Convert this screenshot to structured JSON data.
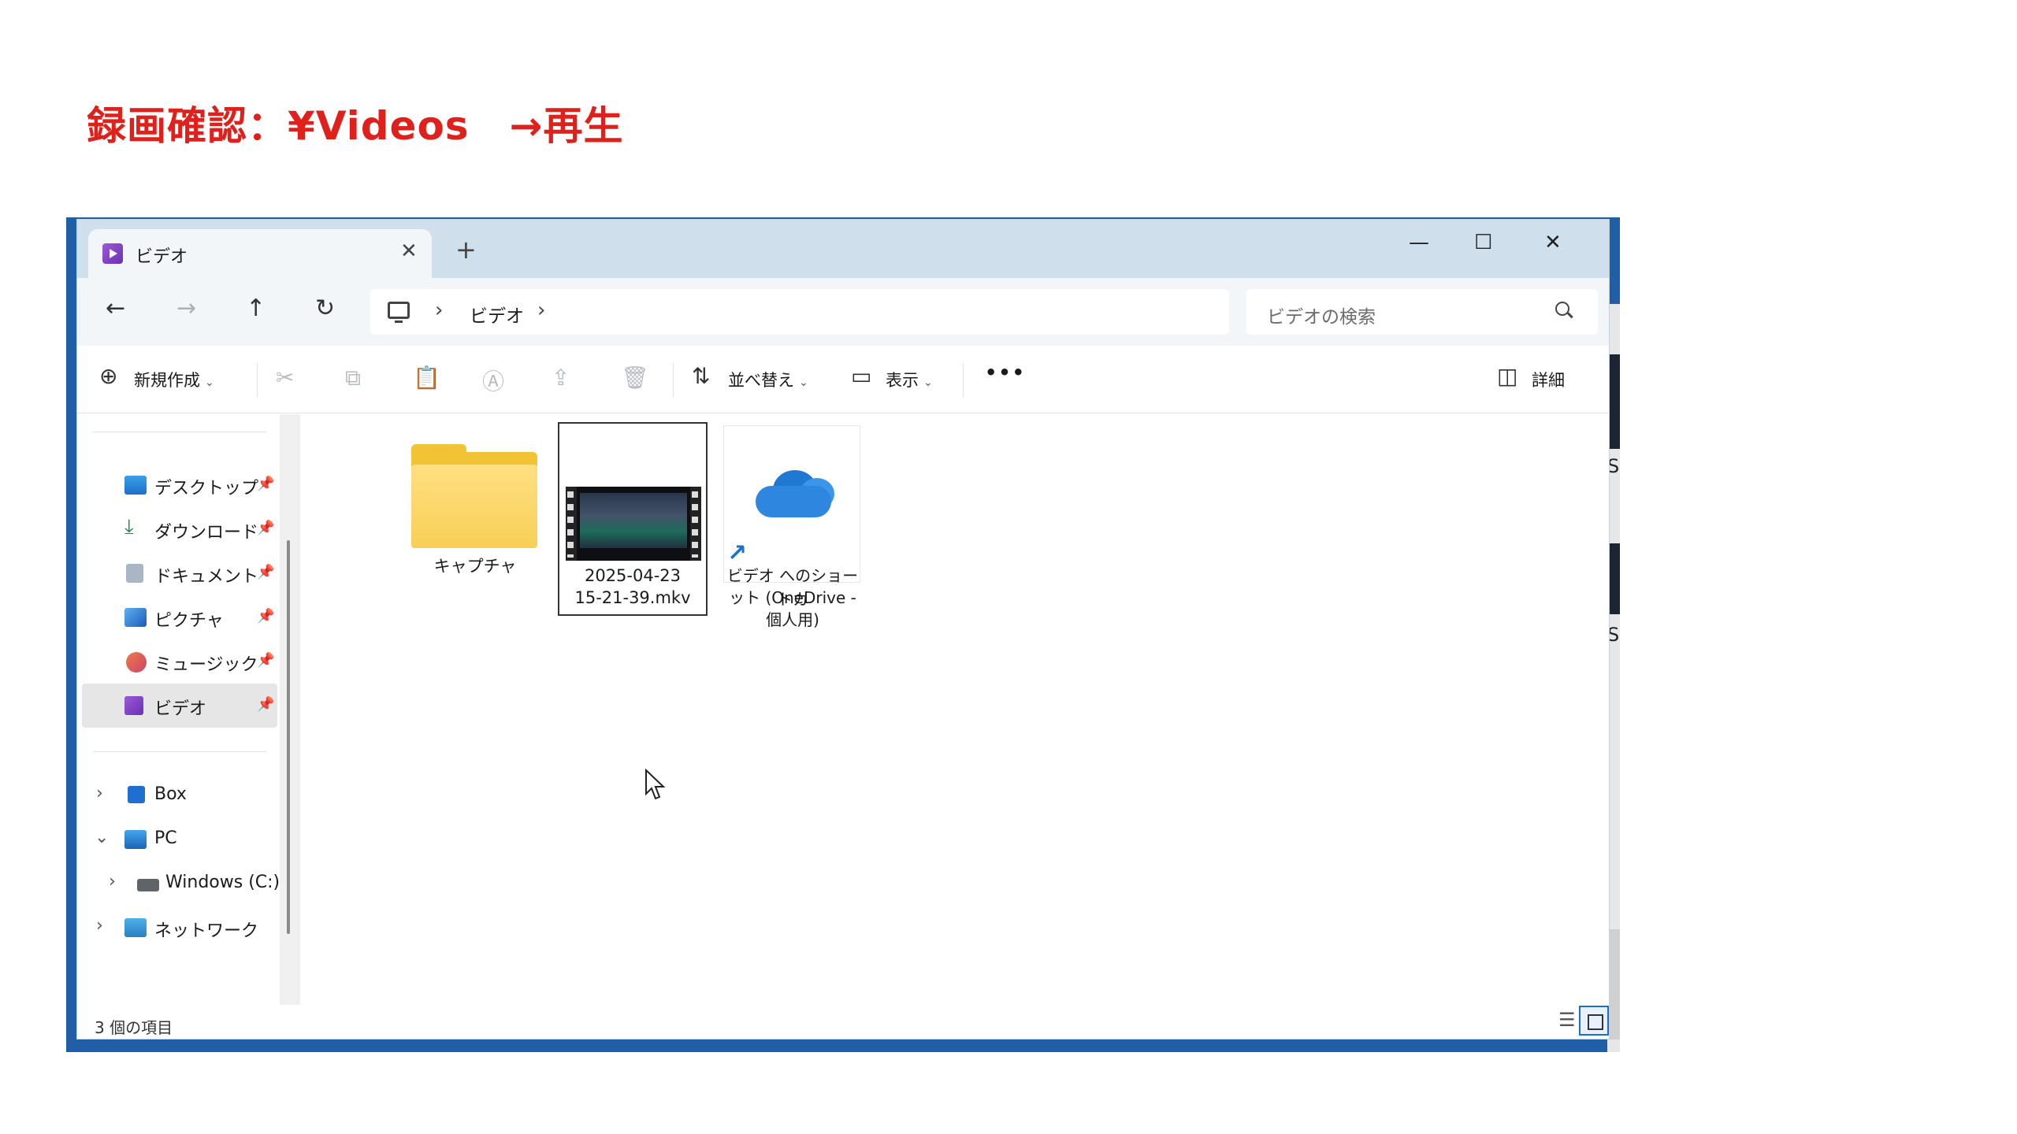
{
  "slide": {
    "title": "録画確認：¥Videos　→再生"
  },
  "window": {
    "tab_title": "ビデオ",
    "tab_close": "✕",
    "new_tab": "+",
    "minimize": "—",
    "maximize": "☐",
    "close": "✕"
  },
  "nav": {
    "back": "←",
    "forward": "→",
    "up": "↑",
    "refresh": "↻",
    "breadcrumb": [
      "ビデオ"
    ],
    "chevron": "›",
    "search_placeholder": "ビデオの検索"
  },
  "commands": {
    "new": "新規作成",
    "sort": "並べ替え",
    "view": "表示",
    "more": "•••",
    "details": "詳細"
  },
  "sidebar": {
    "items": [
      {
        "label": "デスクトップ",
        "icon": "desktop-icon",
        "pinned": true
      },
      {
        "label": "ダウンロード",
        "icon": "download-icon",
        "pinned": true
      },
      {
        "label": "ドキュメント",
        "icon": "document-icon",
        "pinned": true
      },
      {
        "label": "ピクチャ",
        "icon": "pictures-icon",
        "pinned": true
      },
      {
        "label": "ミュージック",
        "icon": "music-icon",
        "pinned": true
      },
      {
        "label": "ビデオ",
        "icon": "video-icon",
        "pinned": true,
        "selected": true
      }
    ],
    "tree": [
      {
        "label": "Box",
        "icon": "box-icon"
      },
      {
        "label": "PC",
        "icon": "pc-icon"
      },
      {
        "label": "Windows (C:)",
        "icon": "drive-icon"
      },
      {
        "label": "ネットワーク",
        "icon": "network-icon"
      }
    ]
  },
  "files": [
    {
      "name": "キャプチャ",
      "type": "folder"
    },
    {
      "name_line1": "2025-04-23",
      "name_line2": "15-21-39.mkv",
      "type": "video",
      "selected": true
    },
    {
      "name_line1": "ビデオ へのショートカ",
      "name_line2": "ット (OneDrive -",
      "name_line3": "個人用)",
      "type": "shortcut"
    }
  ],
  "status": {
    "count": "3 個の項目"
  },
  "background": {
    "s1": "S",
    "s2": "S"
  },
  "colors": {
    "accent": "#1e6fc8",
    "title_red": "#e0201b",
    "folder": "#f3c336"
  }
}
